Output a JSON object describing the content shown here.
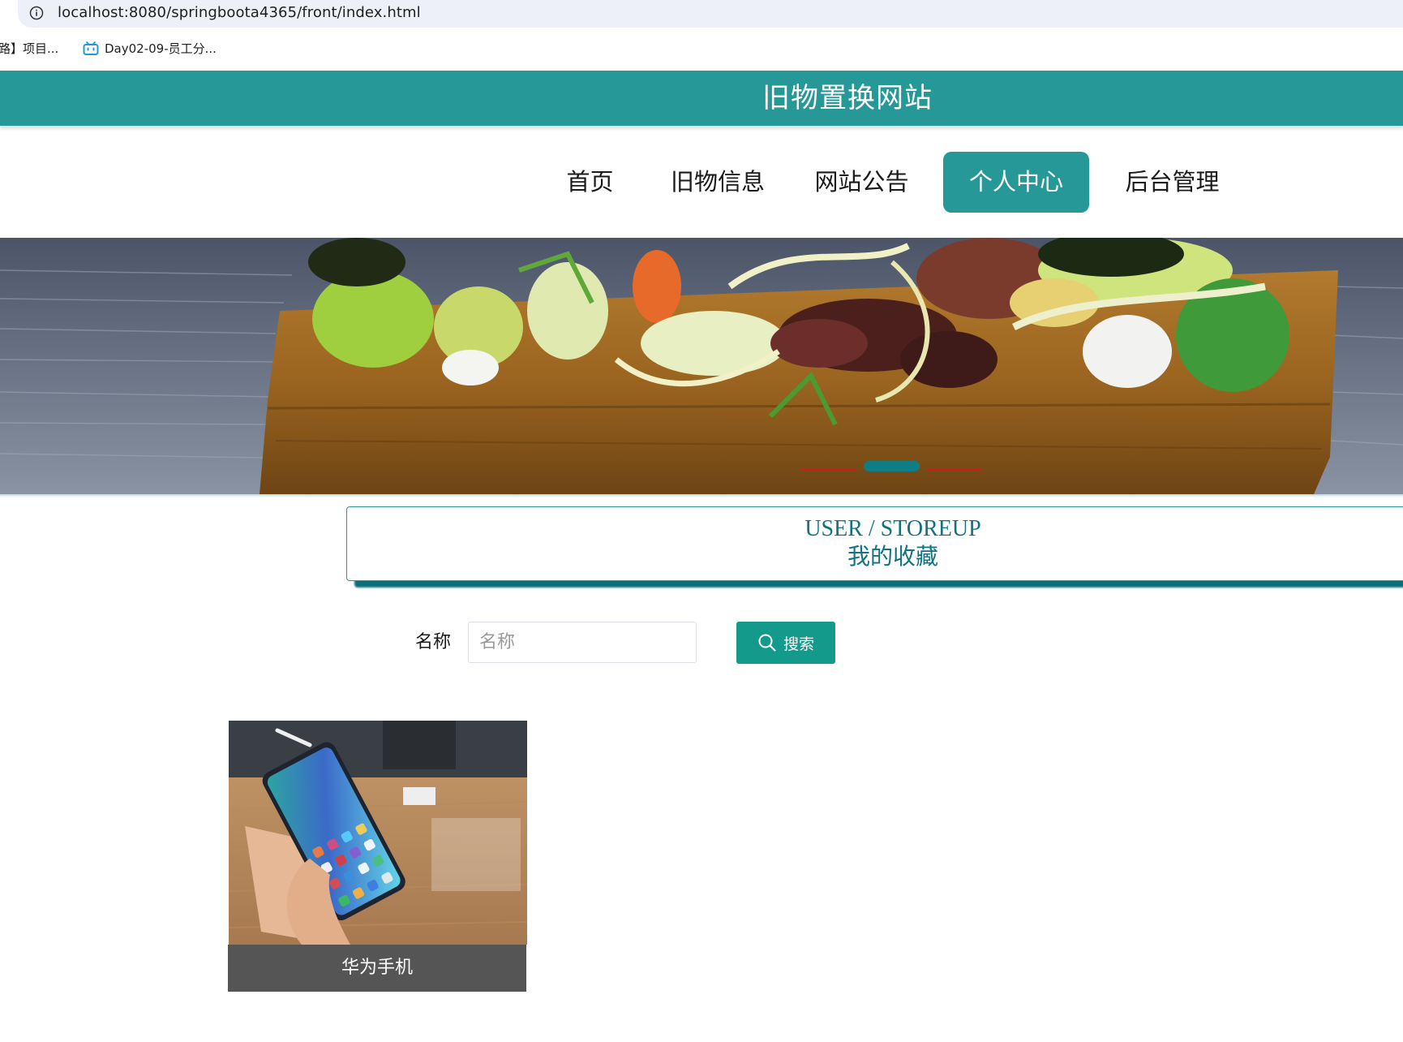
{
  "browser": {
    "url": "localhost:8080/springboota4365/front/index.html",
    "bookmarks": [
      {
        "label": "路】项目..."
      },
      {
        "label": "Day02-09-员工分..."
      }
    ]
  },
  "header": {
    "site_title": "旧物置换网站"
  },
  "nav": {
    "items": [
      {
        "label": "首页",
        "active": false
      },
      {
        "label": "旧物信息",
        "active": false
      },
      {
        "label": "网站公告",
        "active": false
      },
      {
        "label": "个人中心",
        "active": true
      },
      {
        "label": "后台管理",
        "active": false
      }
    ]
  },
  "banner": {
    "active_slide": 2,
    "slide_count": 3
  },
  "section": {
    "title_en": "USER / STOREUP",
    "title_cn": "我的收藏"
  },
  "search": {
    "label": "名称",
    "placeholder": "名称",
    "value": "",
    "button_label": "搜索",
    "icon": "search-icon"
  },
  "products": [
    {
      "name": "华为手机"
    }
  ],
  "colors": {
    "accent": "#279898",
    "section_text": "#137280",
    "button": "#149a8b",
    "caption_bg": "#555555"
  }
}
